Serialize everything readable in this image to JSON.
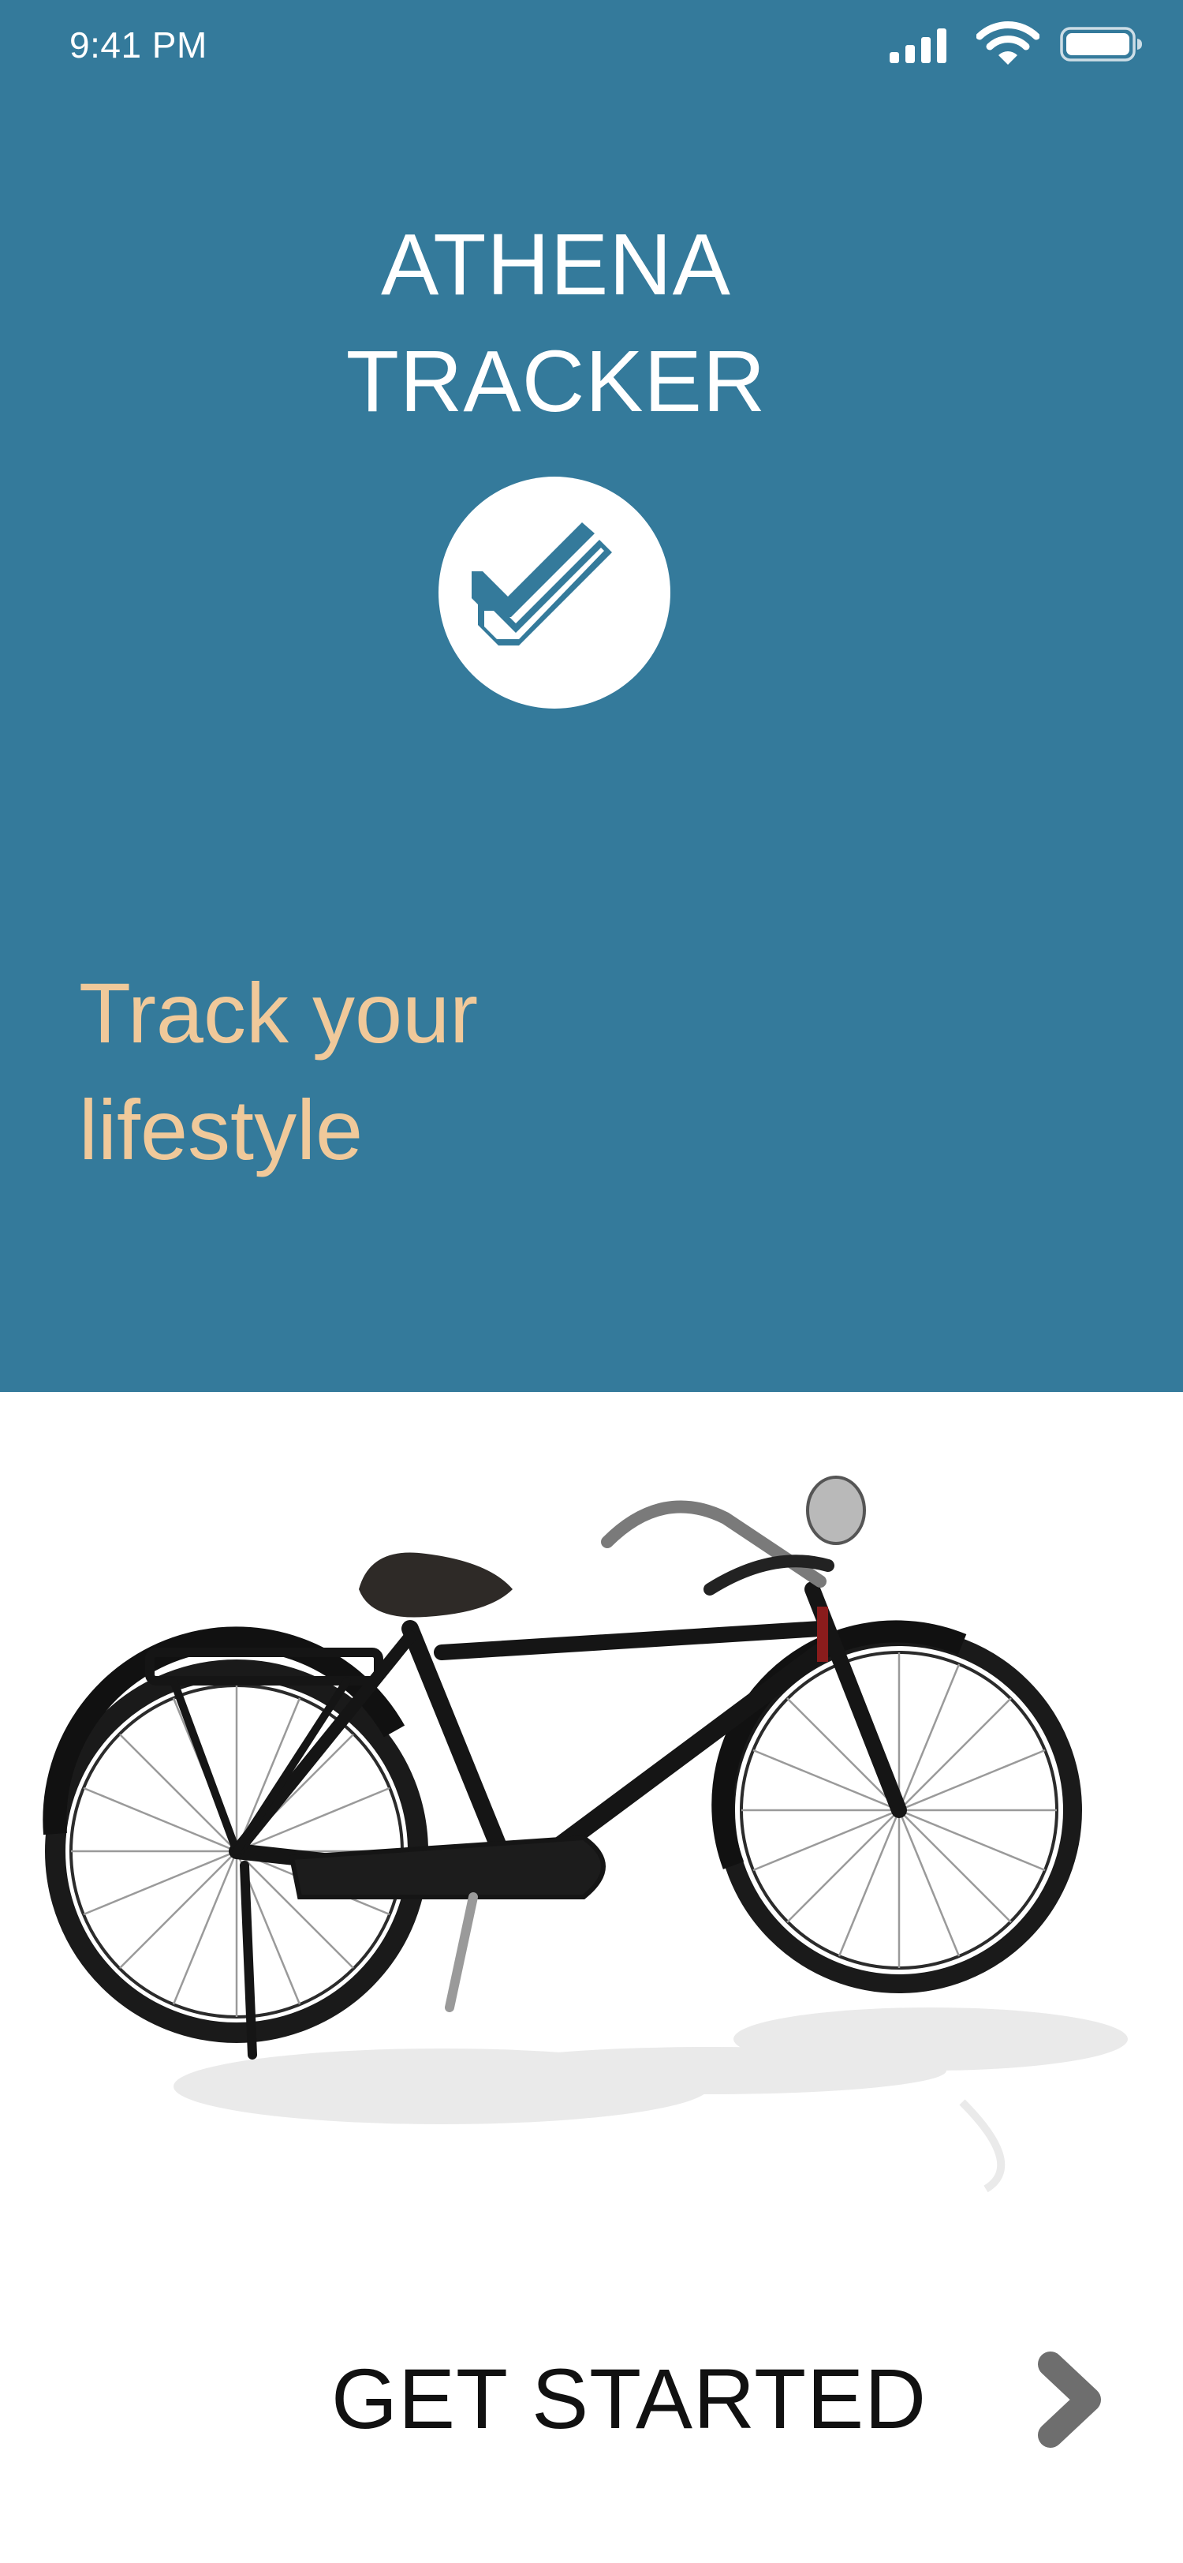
{
  "status_bar": {
    "time": "9:41 PM"
  },
  "header": {
    "title_line1": "ATHENA",
    "title_line2": "TRACKER"
  },
  "hero": {
    "tagline_line1": "Track your",
    "tagline_line2": "lifestyle"
  },
  "cta": {
    "label": "GET STARTED"
  },
  "icons": {
    "logo": "double-checkmark-icon",
    "signal": "cellular-signal-icon",
    "wifi": "wifi-icon",
    "battery": "battery-icon",
    "arrow": "chevron-right-icon"
  },
  "colors": {
    "hero_background": "#347A9B",
    "tagline": "#F0C99A",
    "title": "#FFFFFF",
    "cta_text": "#111111",
    "arrow": "#6E6E6E"
  }
}
